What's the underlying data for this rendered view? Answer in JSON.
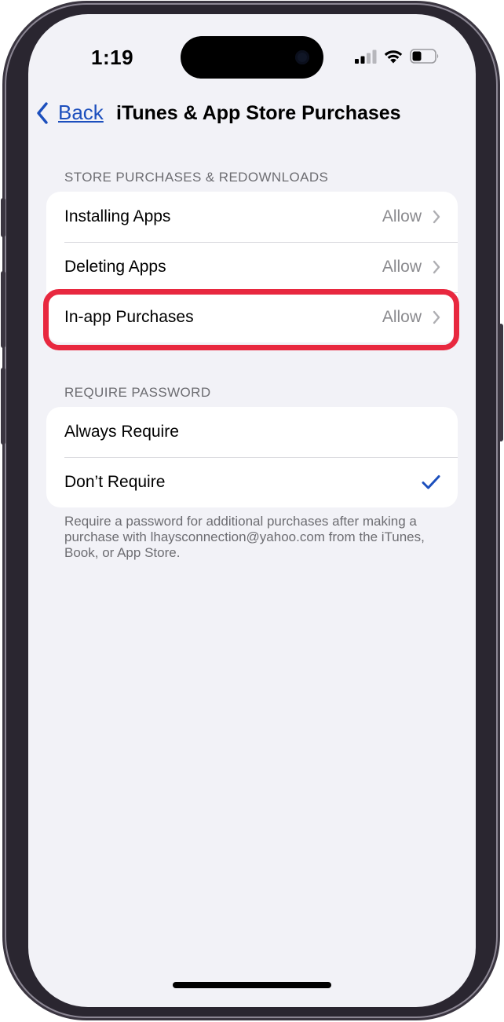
{
  "status_bar": {
    "time": "1:19",
    "signal_icon": "cellular-signal-icon",
    "wifi_icon": "wifi-icon",
    "battery_icon": "battery-icon"
  },
  "nav": {
    "back_label": "Back",
    "title": "iTunes & App Store Purchases"
  },
  "store_section": {
    "header": "STORE PURCHASES & REDOWNLOADS",
    "rows": [
      {
        "label": "Installing Apps",
        "value": "Allow"
      },
      {
        "label": "Deleting Apps",
        "value": "Allow"
      },
      {
        "label": "In-app Purchases",
        "value": "Allow"
      }
    ]
  },
  "password_section": {
    "header": "REQUIRE PASSWORD",
    "rows": [
      {
        "label": "Always Require",
        "selected": false
      },
      {
        "label": "Don’t Require",
        "selected": true
      }
    ],
    "footer": "Require a password for additional purchases after making a purchase with lhaysconnection@yahoo.com from the iTunes, Book, or App Store."
  },
  "colors": {
    "accent": "#1c4fbd",
    "highlight": "#e8283f",
    "background": "#f2f2f7"
  }
}
